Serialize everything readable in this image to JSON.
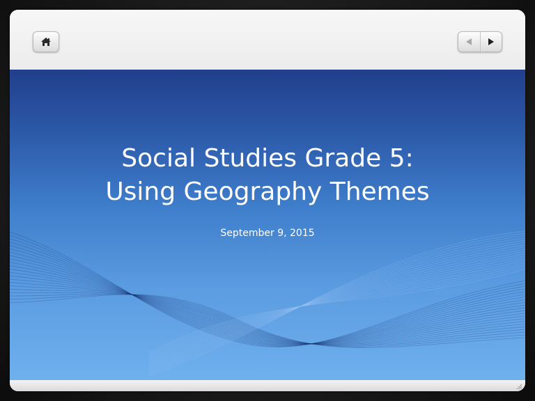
{
  "slide": {
    "title_line1": "Social Studies Grade 5:",
    "title_line2": "Using Geography Themes",
    "subtitle": "September 9, 2015"
  },
  "toolbar": {
    "home_icon": "home-icon",
    "prev_icon": "triangle-left-icon",
    "next_icon": "triangle-right-icon"
  },
  "colors": {
    "slide_top": "#213f8a",
    "slide_bottom": "#6fb0ee",
    "frame": "#f2f2f2",
    "backdrop": "#1c1c1c"
  }
}
